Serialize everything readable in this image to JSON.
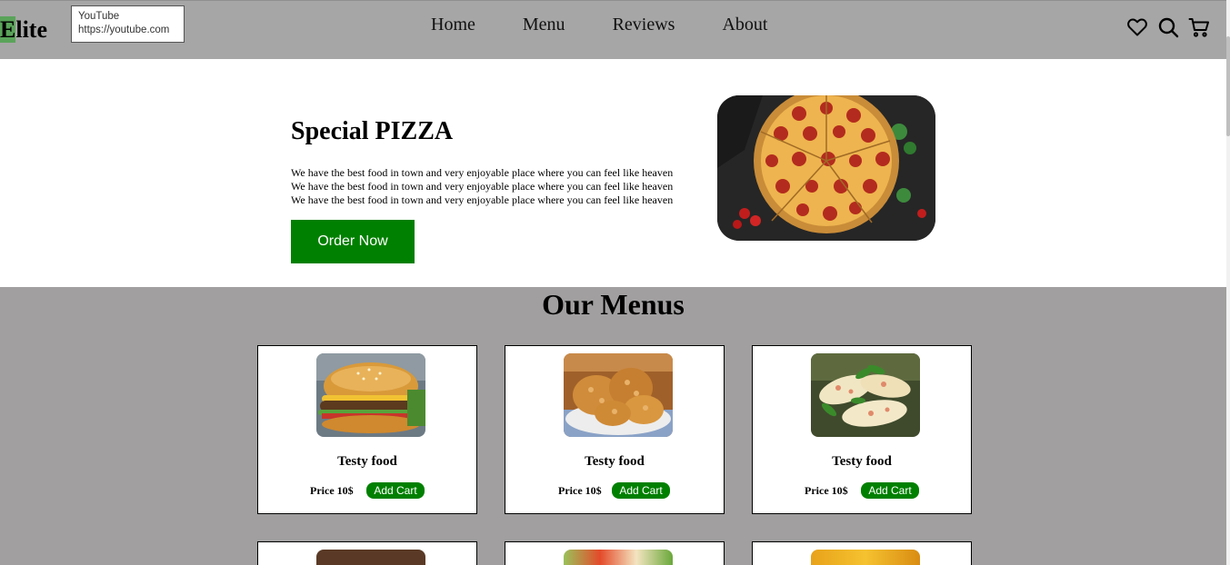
{
  "brand": {
    "first_letter": "E",
    "rest": "lite"
  },
  "tooltip": {
    "title": "YouTube",
    "url": "https://youtube.com"
  },
  "nav": {
    "items": [
      "Home",
      "Menu",
      "Reviews",
      "About"
    ]
  },
  "icons": {
    "wishlist": "heart-icon",
    "search": "search-icon",
    "cart": "cart-icon"
  },
  "hero": {
    "title": "Special PIZZA",
    "lines": [
      "We have the best food in town and very enjoyable place where you can feel like heaven",
      "We have the best food in town and very enjoyable place where you can feel like heaven",
      "We have the best food in town and very enjoyable place where you can feel like heaven"
    ],
    "button": "Order Now"
  },
  "menus": {
    "title": "Our Menus",
    "cards": [
      {
        "name": "Testy food",
        "price": "Price 10$",
        "button": "Add Cart"
      },
      {
        "name": "Testy food",
        "price": "Price 10$",
        "button": "Add Cart"
      },
      {
        "name": "Testy food",
        "price": "Price 10$",
        "button": "Add Cart"
      }
    ]
  },
  "colors": {
    "nav_bg": "#a6a6a6",
    "section_bg": "#a19f9f",
    "accent": "#008000",
    "logo_highlight": "#5aa35a"
  }
}
